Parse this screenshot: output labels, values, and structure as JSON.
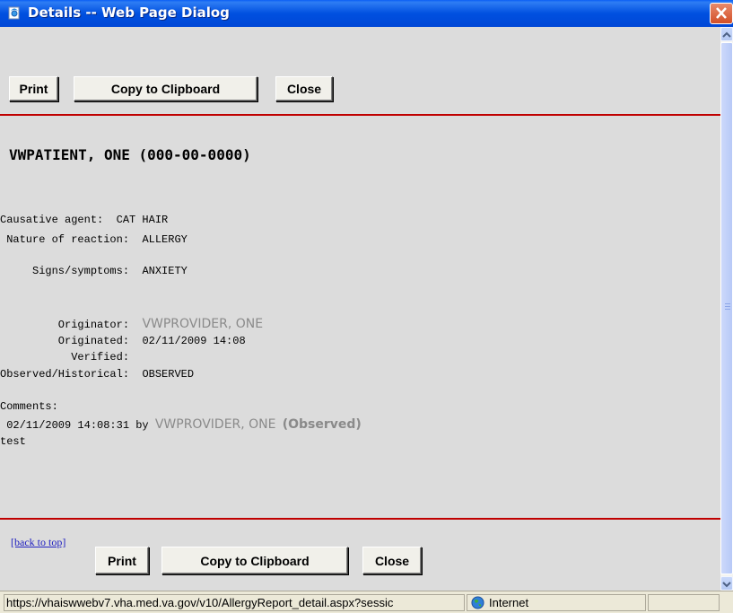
{
  "window": {
    "title": "Details -- Web Page Dialog"
  },
  "toolbar_top": {
    "print": "Print",
    "copy": "Copy to Clipboard",
    "close": "Close"
  },
  "patient": {
    "header": "VWPATIENT, ONE (000-00-0000)"
  },
  "allergy": {
    "causative_label": "Causative agent:",
    "causative_value": "CAT HAIR",
    "nature_label": " Nature of reaction:",
    "nature_value": "ALLERGY",
    "signs_label": "     Signs/symptoms:",
    "signs_value": "ANXIETY",
    "originator_label": "         Originator:",
    "originator_value": "VWPROVIDER, ONE",
    "originated_label": "         Originated:",
    "originated_value": "02/11/2009 14:08",
    "verified_label": "           Verified:",
    "observed_label": "Observed/Historical:",
    "observed_value": "OBSERVED"
  },
  "comments": {
    "label": "Comments:",
    "timestamp": " 02/11/2009 14:08:31 by",
    "author": "VWPROVIDER, ONE",
    "status": "(Observed)",
    "text": "test"
  },
  "footer": {
    "back_to_top": "[back to top]",
    "print": "Print",
    "copy": "Copy to Clipboard",
    "close": "Close"
  },
  "statusbar": {
    "url": "https://vhaiswwebv7.vha.med.va.gov/v10/AllergyReport_detail.aspx?sessic",
    "zone": "Internet"
  },
  "colors": {
    "title_bar": "#0054e3",
    "divider": "#c00000",
    "link": "#2020c0",
    "muted_text": "#8a8a8a"
  },
  "icons": [
    "ie-page-icon",
    "close-icon",
    "scroll-up-icon",
    "scroll-down-icon",
    "internet-globe-icon"
  ]
}
